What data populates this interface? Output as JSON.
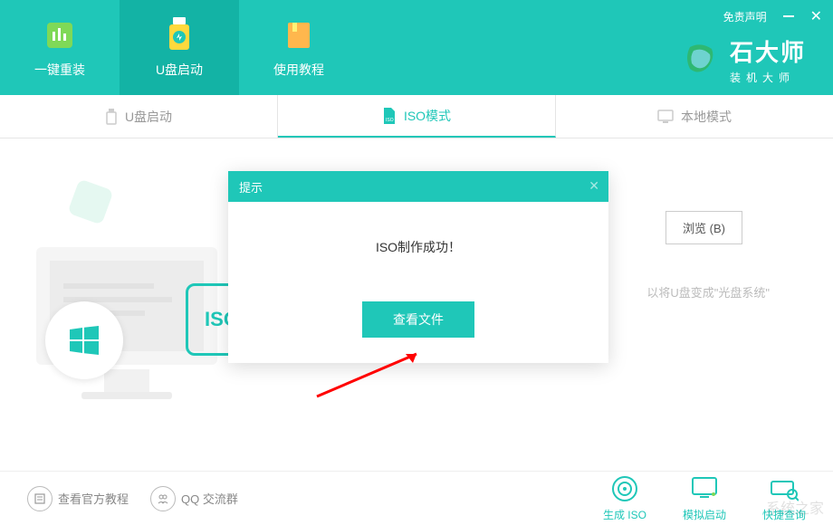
{
  "header": {
    "disclaimer": "免责声明",
    "nav": [
      {
        "label": "一键重装"
      },
      {
        "label": "U盘启动"
      },
      {
        "label": "使用教程"
      }
    ],
    "brand_title": "石大师",
    "brand_sub": "装机大师"
  },
  "tabs": [
    {
      "label": "U盘启动"
    },
    {
      "label": "ISO模式"
    },
    {
      "label": "本地模式"
    }
  ],
  "main": {
    "browse_label": "浏览 (B)",
    "hint_text": "以将U盘变成\"光盘系统\"",
    "iso_label": "ISO"
  },
  "dialog": {
    "title": "提示",
    "message": "ISO制作成功！",
    "button": "查看文件"
  },
  "footer": {
    "left": [
      {
        "label": "查看官方教程"
      },
      {
        "label": "QQ 交流群"
      }
    ],
    "actions": [
      {
        "label": "生成 ISO"
      },
      {
        "label": "模拟启动"
      },
      {
        "label": "快捷查询"
      }
    ]
  },
  "watermark": "系统之家"
}
